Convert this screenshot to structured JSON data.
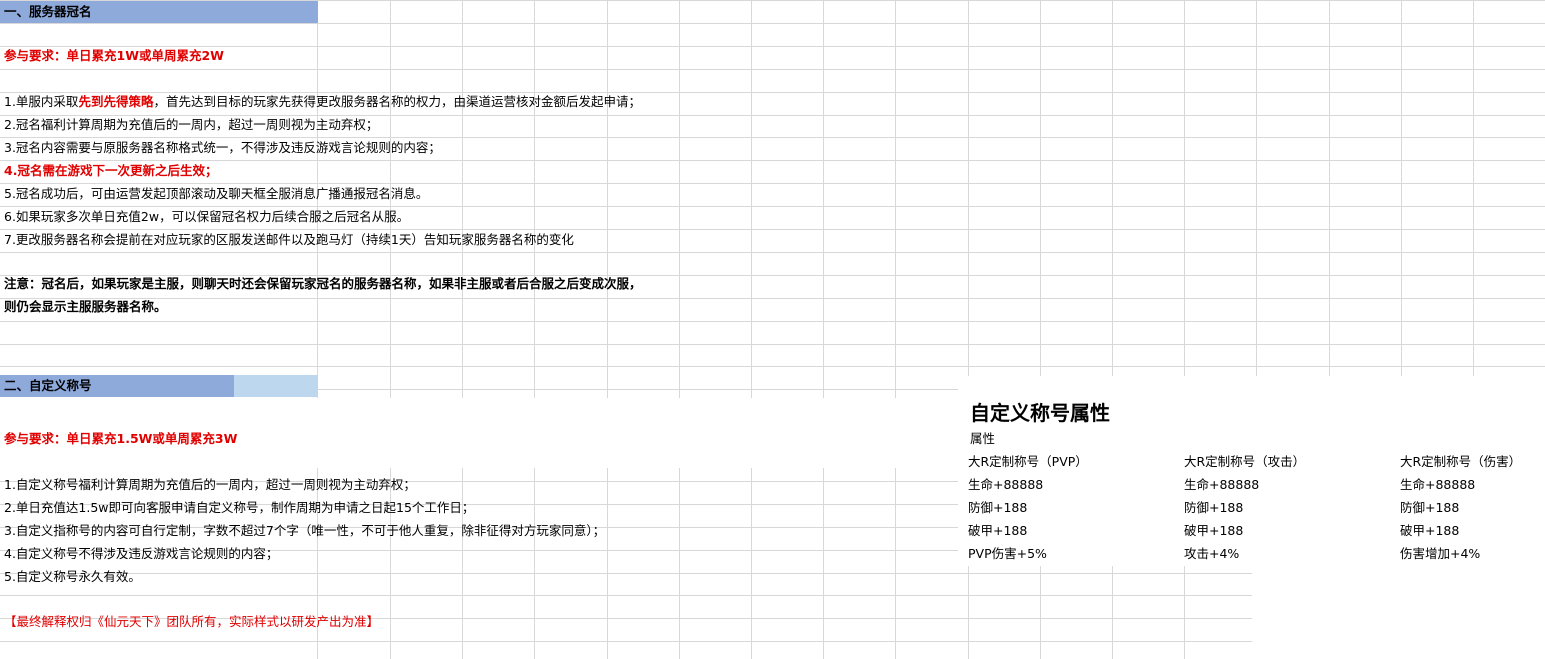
{
  "colors": {
    "header_blue": "#8eaadb",
    "header_lightblue": "#bdd7ee",
    "red": "#e00000",
    "grid": "#d8d8d8"
  },
  "section1": {
    "title": "一、服务器冠名",
    "requirement": "参与要求：单日累充1W或单周累充2W",
    "rule1": {
      "prefix": "1.单服内采取",
      "highlight": "先到先得策略",
      "suffix": "，首先达到目标的玩家先获得更改服务器名称的权力，由渠道运营核对金额后发起申请；"
    },
    "rules": [
      "2.冠名福利计算周期为充值后的一周内，超过一周则视为主动弃权；",
      "3.冠名内容需要与原服务器名称格式统一，不得涉及违反游戏言论规则的内容；",
      "4.冠名需在游戏下一次更新之后生效；",
      "5.冠名成功后，可由运营发起顶部滚动及聊天框全服消息广播通报冠名消息。",
      "6.如果玩家多次单日充值2w，可以保留冠名权力后续合服之后冠名从服。",
      "7.更改服务器名称会提前在对应玩家的区服发送邮件以及跑马灯（持续1天）告知玩家服务器名称的变化"
    ],
    "note_line1": "注意：冠名后，如果玩家是主服，则聊天时还会保留玩家冠名的服务器名称，如果非主服或者后合服之后变成次服，",
    "note_line2": "则仍会显示主服服务器名称。"
  },
  "section2": {
    "title": "二、自定义称号",
    "requirement": "参与要求：单日累充1.5W或单周累充3W",
    "rules": [
      "1.自定义称号福利计算周期为充值后的一周内，超过一周则视为主动弃权；",
      "2.单日充值达1.5w即可向客服申请自定义称号，制作周期为申请之日起15个工作日；",
      "3.自定义指称号的内容可自行定制，字数不超过7个字（唯一性，不可于他人重复，除非征得对方玩家同意）；",
      "4.自定义称号不得涉及违反游戏言论规则的内容；",
      "5.自定义称号永久有效。"
    ],
    "footer": "【最终解释权归《仙元天下》团队所有，实际样式以研发产出为准】"
  },
  "attributes": {
    "title": "自定义称号属性",
    "subtitle": "属性",
    "columns": [
      {
        "name": "大R定制称号（PVP）",
        "items": [
          "生命+88888",
          "防御+188",
          "破甲+188",
          "PVP伤害+5%"
        ]
      },
      {
        "name": "大R定制称号（攻击）",
        "items": [
          "生命+88888",
          "防御+188",
          "破甲+188",
          "攻击+4%"
        ]
      },
      {
        "name": "大R定制称号（伤害）",
        "items": [
          "生命+88888",
          "防御+188",
          "破甲+188",
          "伤害增加+4%"
        ]
      }
    ]
  }
}
